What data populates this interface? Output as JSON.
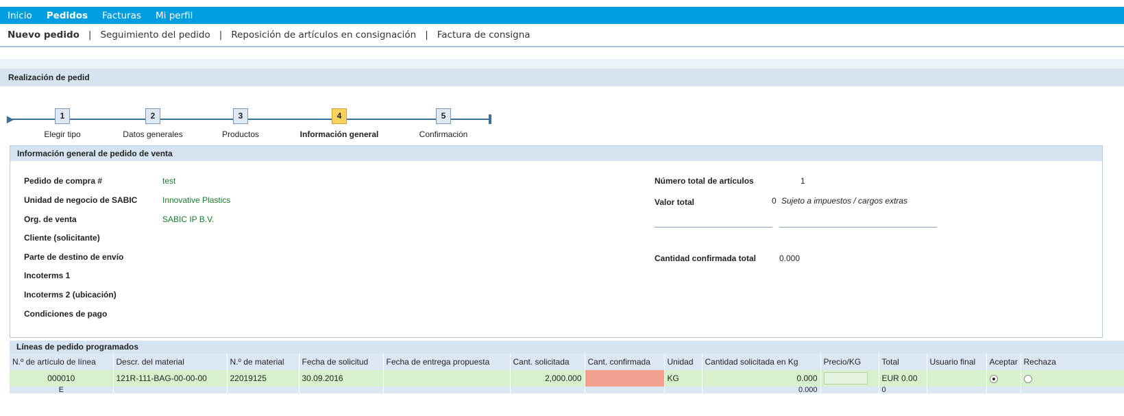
{
  "topnav": {
    "items": [
      "Inicio",
      "Pedidos",
      "Facturas",
      "Mi perfil"
    ],
    "active": 1
  },
  "subnav": {
    "items": [
      "Nuevo pedido",
      "Seguimiento del pedido",
      "Reposición de artículos en consignación",
      "Factura de consigna"
    ],
    "separator": "|"
  },
  "page_title": "Realización de pedid",
  "steps": [
    {
      "number": "1",
      "label": "Elegir tipo"
    },
    {
      "number": "2",
      "label": "Datos generales"
    },
    {
      "number": "3",
      "label": "Productos"
    },
    {
      "number": "4",
      "label": "Información general",
      "current": true
    },
    {
      "number": "5",
      "label": "Confirmación"
    }
  ],
  "general": {
    "title": "Información general de pedido de venta",
    "po_label": "Pedido de compra #",
    "po_value": "test",
    "bu_label": "Unidad de negocio de SABIC",
    "bu_value": "Innovative Plastics",
    "org_label": "Org. de venta",
    "org_value": "SABIC IP B.V.",
    "customer_label": "Cliente (solicitante)",
    "shipto_label": "Parte de destino de envío",
    "inco1_label": "Incoterms 1",
    "inco2_label": "Incoterms 2 (ubicación)",
    "payment_label": "Condiciones de pago",
    "total_items_label": "Número total de artículos",
    "total_items_value": "1",
    "total_value_label": "Valor total",
    "total_value_value": "0",
    "total_value_note": "Sujeto a impuestos / cargos extras",
    "confirmed_qty_label": "Cantidad confirmada total",
    "confirmed_qty_value": "0.000"
  },
  "lines": {
    "title": "Líneas de pedido programados",
    "columns": [
      "N.º de artículo de línea",
      "Descr. del material",
      "N.º de material",
      "Fecha de solicitud",
      "Fecha de entrega propuesta",
      "Cant. solicitada",
      "Cant. confirmada",
      "Unidad",
      "Cantidad solicitada en Kg",
      "Precio/KG",
      "Total",
      "Usuario final",
      "Aceptar",
      "Rechaza"
    ],
    "row1": {
      "line_no": "000010",
      "descr": "121R-111-BAG-00-00-00",
      "material": "22019125",
      "req_date": "30.09.2016",
      "proposed_date": "",
      "qty_req": "2,000.000",
      "qty_conf": "",
      "unit": "KG",
      "qty_kg": "0.000",
      "price": "",
      "total": "EUR 0.00",
      "end_user": "",
      "accept": true,
      "reject": false
    },
    "row2": {
      "line_no": "E",
      "qty_kg": "0.000",
      "total": "0"
    }
  }
}
